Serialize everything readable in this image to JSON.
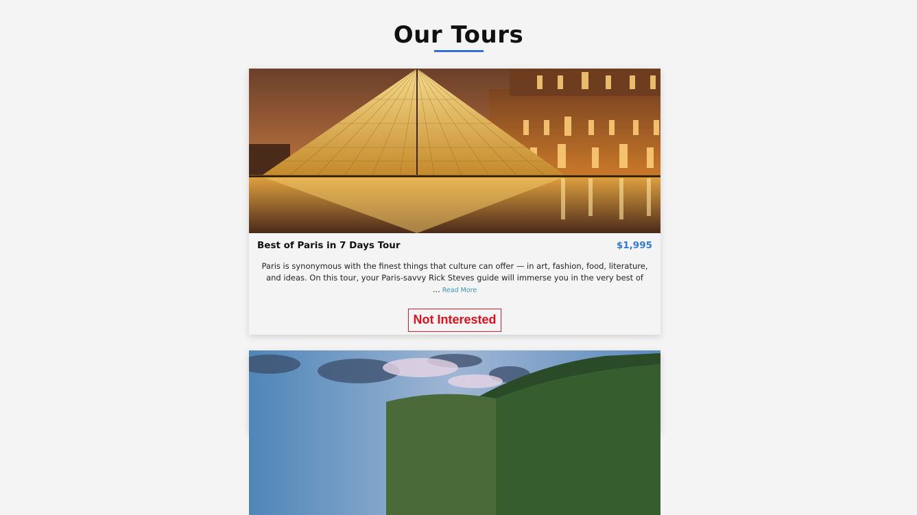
{
  "page": {
    "title": "Our Tours"
  },
  "tours": [
    {
      "name": "Best of Paris in 7 Days Tour",
      "price": "$1,995",
      "description": "Paris is synonymous with the finest things that culture can offer — in art, fashion, food, literature, and ideas. On this tour, your Paris-savvy Rick Steves guide will immerse you in the very best of ...",
      "read_more_label": "Read More",
      "not_interested_label": "Not Interested",
      "image_icon": "louvre-pyramid-photo"
    },
    {
      "image_icon": "mountain-landscape-photo"
    }
  ],
  "colors": {
    "accent": "#2f6fd6",
    "price": "#2f7ad6",
    "danger": "#e0101a",
    "link": "#3a95b8",
    "background": "#f4f4f4"
  }
}
